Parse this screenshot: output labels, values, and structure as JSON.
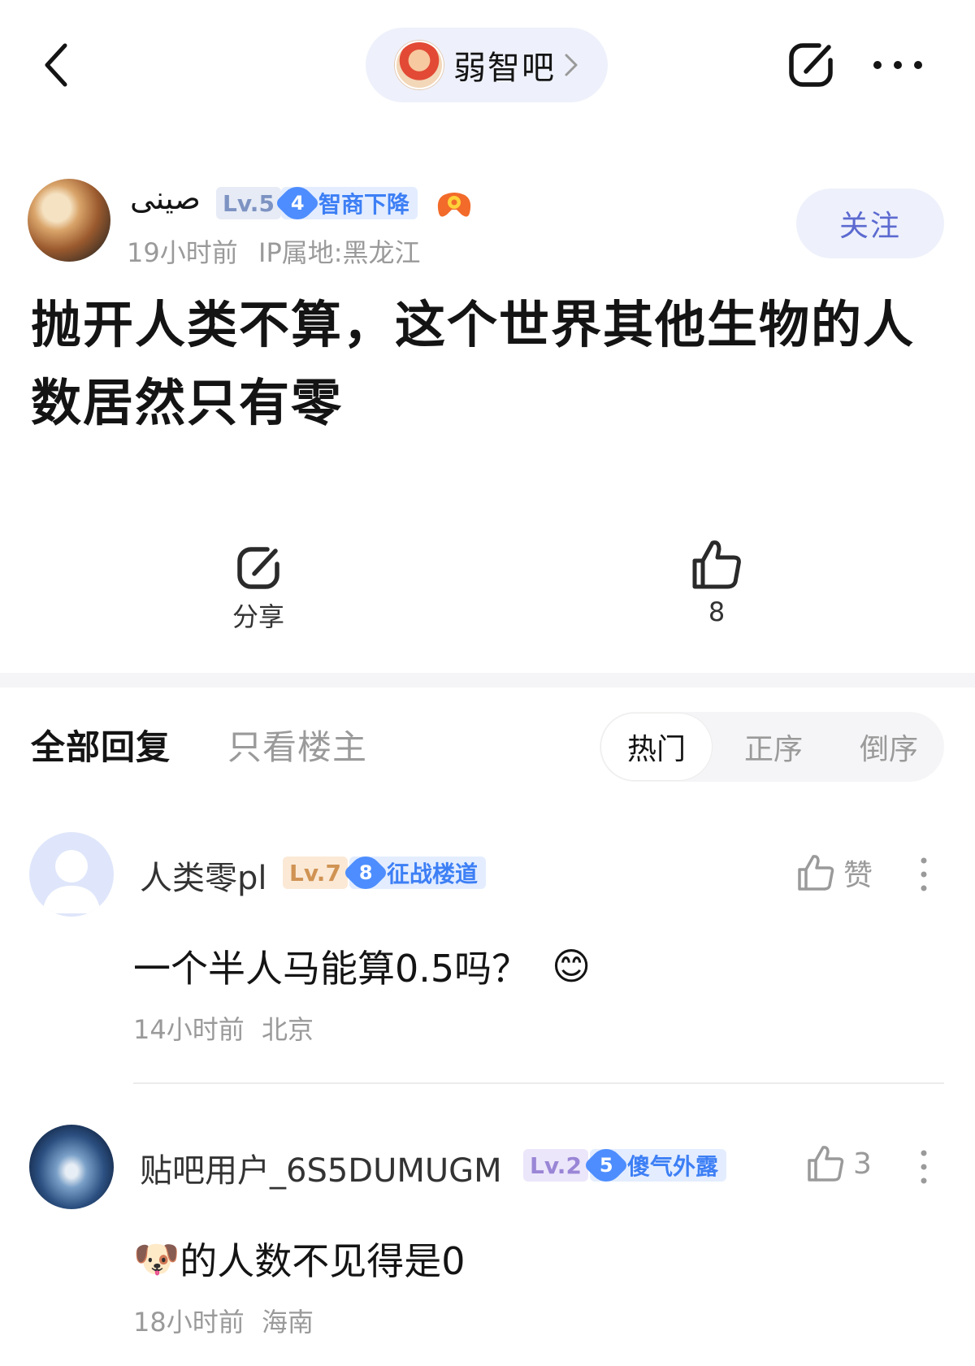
{
  "header": {
    "forum_name": "弱智吧",
    "icons": [
      "back-icon",
      "chevron-right-icon",
      "share-icon",
      "more-icon"
    ]
  },
  "post": {
    "author": {
      "name": "صينى",
      "level": "Lv.5",
      "rank_number": "4",
      "rank_title": "智商下降",
      "time": "19小时前",
      "ip": "IP属地:黑龙江"
    },
    "follow_label": "关注",
    "title": "抛开人类不算，这个世界其他生物的人数居然只有零",
    "actions": {
      "share_label": "分享",
      "like_count": "8"
    }
  },
  "replies": {
    "tabs": {
      "all": "全部回复",
      "op_only": "只看楼主"
    },
    "sort": {
      "hot": "热门",
      "asc": "正序",
      "desc": "倒序",
      "selected": "热门"
    },
    "comments": [
      {
        "name": "人类零pl",
        "level": "Lv.7",
        "rank_number": "8",
        "rank_title": "征战楼道",
        "like_text": "赞",
        "content": "一个半人马能算0.5吗？",
        "emoji": "😊",
        "time": "14小时前",
        "location": "北京"
      },
      {
        "name": "贴吧用户_6S5DUMUGM",
        "level": "Lv.2",
        "rank_number": "5",
        "rank_title": "傻气外露",
        "like_text": "3",
        "emoji": "🐶",
        "content": "的人数不见得是0",
        "time": "18小时前",
        "location": "海南"
      }
    ]
  },
  "colors": {
    "accent": "#5c6ad0",
    "pill_bg": "#eef1fb",
    "rank_blue": "#4d8dff",
    "muted_text": "#9a9a9a"
  }
}
